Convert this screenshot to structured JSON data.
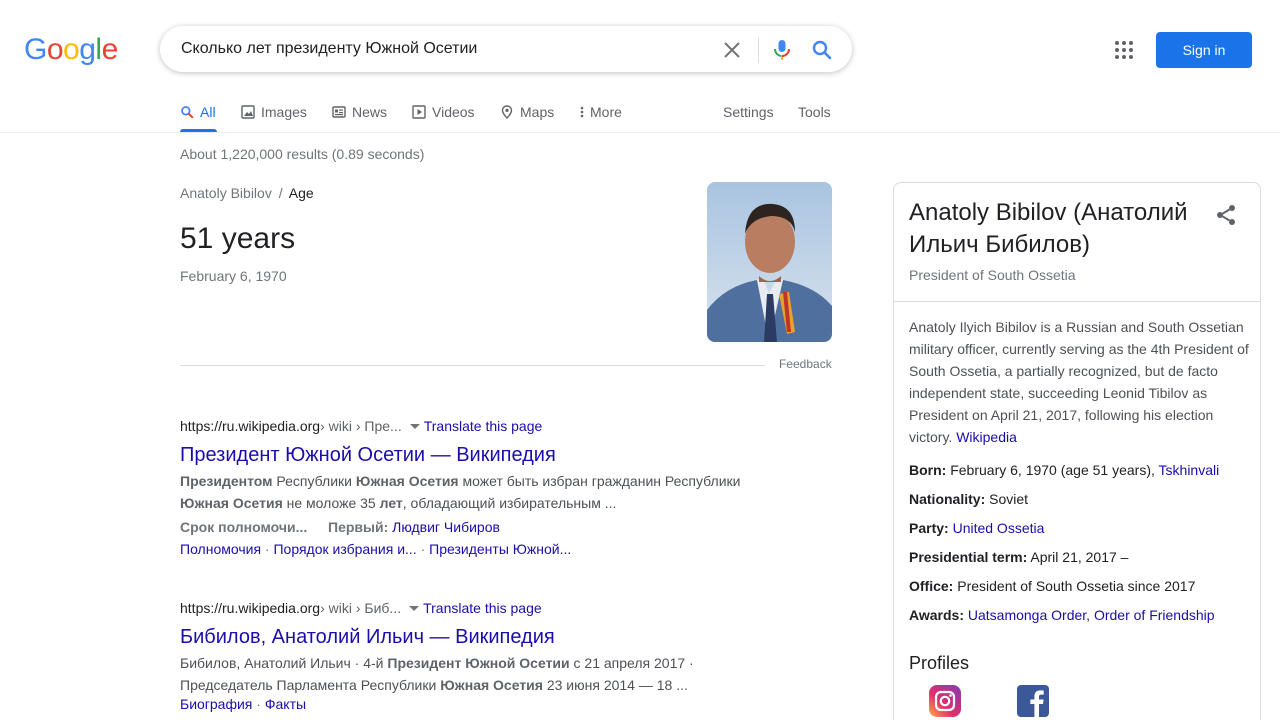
{
  "logo": "Google",
  "search": {
    "query": "Сколько лет президенту Южной Осетии"
  },
  "header": {
    "signin_label": "Sign in"
  },
  "tabs": {
    "all": "All",
    "images": "Images",
    "news": "News",
    "videos": "Videos",
    "maps": "Maps",
    "more": "More",
    "settings": "Settings",
    "tools": "Tools"
  },
  "result_stats": "About 1,220,000 results (0.89 seconds)",
  "answer": {
    "breadcrumb_entity": "Anatoly Bibilov",
    "breadcrumb_sep": "/",
    "breadcrumb_attr": "Age",
    "value": "51 years",
    "sub": "February 6, 1970",
    "feedback": "Feedback"
  },
  "results": [
    {
      "url": "https://ru.wikipedia.org",
      "path": " › wiki › Пре...",
      "translate": "Translate this page",
      "title": "Президент Южной Осетии — Википедия",
      "snippet_parts": [
        "Президентом",
        " Республики ",
        "Южная Осетия",
        " может быть избран гражданин Республики ",
        "Южная Осетия",
        " не моложе 35 ",
        "лет",
        ", обладающий избирательным ..."
      ],
      "meta": [
        {
          "key": "Срок полномочи...",
          "value": ""
        },
        {
          "key": "Первый:",
          "value": "Людвиг Чибиров"
        }
      ],
      "links": [
        "Полномочия",
        "Порядок избрания и...",
        "Президенты Южной..."
      ]
    },
    {
      "url": "https://ru.wikipedia.org",
      "path": " › wiki › Биб...",
      "translate": "Translate this page",
      "title": "Бибилов, Анатолий Ильич — Википедия",
      "snippet_parts": [
        "Бибилов, Анатолий Ильич · 4-й ",
        "Президент Южной Осетии",
        " с 21 апреля 2017 · Председатель Парламента Республики ",
        "Южная Осетия",
        " 23 июня 2014 — 18 ..."
      ],
      "links": [
        "Биография",
        "Факты"
      ]
    }
  ],
  "knowledge_panel": {
    "title": "Anatoly Bibilov (Анатолий Ильич Бибилов)",
    "subtitle": "President of South Ossetia",
    "description": "Anatoly Ilyich Bibilov is a Russian and South Ossetian military officer, currently serving as the 4th President of South Ossetia, a partially recognized, but de facto independent state, succeeding Leonid Tibilov as President on April 21, 2017, following his election victory.",
    "description_source": "Wikipedia",
    "facts": {
      "born_label": "Born:",
      "born_value": "February 6, 1970 (age 51 years),",
      "born_link": "Tskhinvali",
      "nationality_label": "Nationality:",
      "nationality_value": "Soviet",
      "party_label": "Party:",
      "party_link": "United Ossetia",
      "term_label": "Presidential term:",
      "term_value": "April 21, 2017 –",
      "office_label": "Office:",
      "office_value": "President of South Ossetia since 2017",
      "awards_label": "Awards:",
      "awards_link1": "Uatsamonga Order",
      "awards_sep": ",",
      "awards_link2": "Order of Friendship"
    },
    "profiles_heading": "Profiles"
  },
  "colors": {
    "link": "#1a0dab",
    "accent": "#1a73e8",
    "google_blue": "#4285f4",
    "google_red": "#ea4335",
    "google_yellow": "#fbbc05",
    "google_green": "#34a853"
  }
}
